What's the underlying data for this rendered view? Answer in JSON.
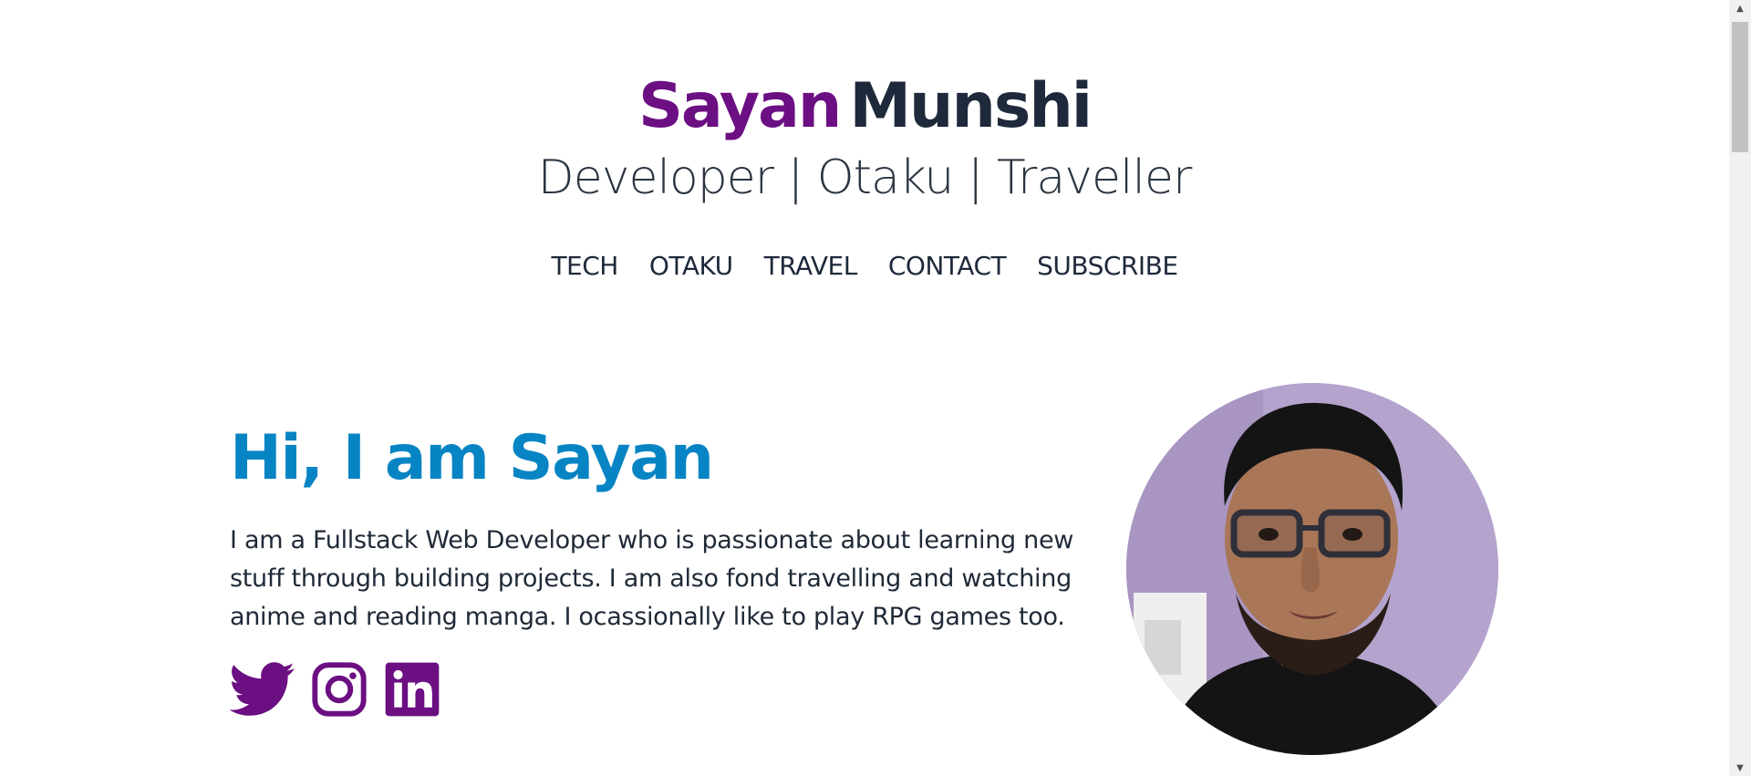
{
  "header": {
    "name_first": "Sayan",
    "name_last": "Munshi",
    "tagline": "Developer | Otaku | Traveller"
  },
  "nav": {
    "items": [
      "TECH",
      "OTAKU",
      "TRAVEL",
      "CONTACT",
      "SUBSCRIBE"
    ]
  },
  "hero": {
    "title": "Hi, I am Sayan",
    "bio": "I am a Fullstack Web Developer who is passionate about learning new stuff through building projects. I am also fond travelling and watching anime and reading manga. I ocassionally like to play RPG games too."
  },
  "socials": [
    {
      "icon": "twitter-icon"
    },
    {
      "icon": "instagram-icon"
    },
    {
      "icon": "linkedin-icon"
    }
  ],
  "colors": {
    "brand_purple": "#6b0f82",
    "heading_blue": "#0784c3",
    "text_dark": "#1e293b",
    "avatar_bg": "#b7a5cf"
  }
}
